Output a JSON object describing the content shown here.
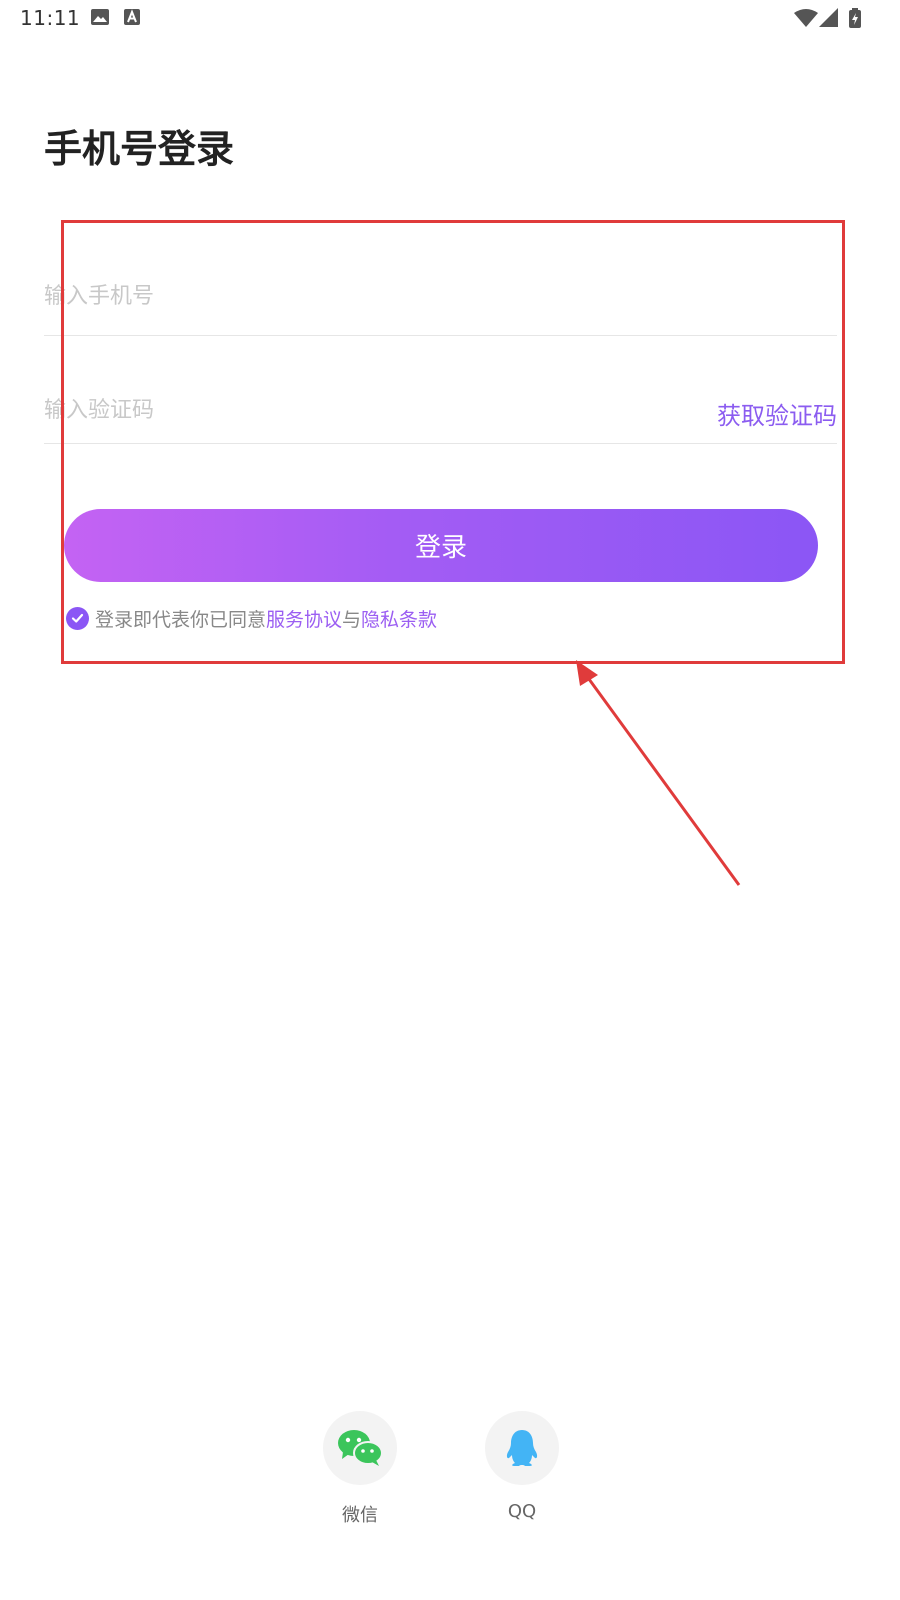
{
  "statusbar": {
    "time": "11:11"
  },
  "page": {
    "title": "手机号登录"
  },
  "form": {
    "phone_placeholder": "输入手机号",
    "phone_value": "",
    "code_placeholder": "输入验证码",
    "code_value": "",
    "get_code_label": "获取验证码",
    "login_label": "登录"
  },
  "agreement": {
    "checked": true,
    "prefix": "登录即代表你已同意",
    "service_link": "服务协议",
    "conjunction": "与",
    "privacy_link": "隐私条款"
  },
  "social": [
    {
      "label": "微信",
      "icon": "wechat-icon"
    },
    {
      "label": "QQ",
      "icon": "qq-icon"
    }
  ],
  "colors": {
    "accent": "#8b56f5",
    "gradient_start": "#c463f3",
    "gradient_end": "#8b56f5",
    "annotation": "#e03b3b"
  }
}
